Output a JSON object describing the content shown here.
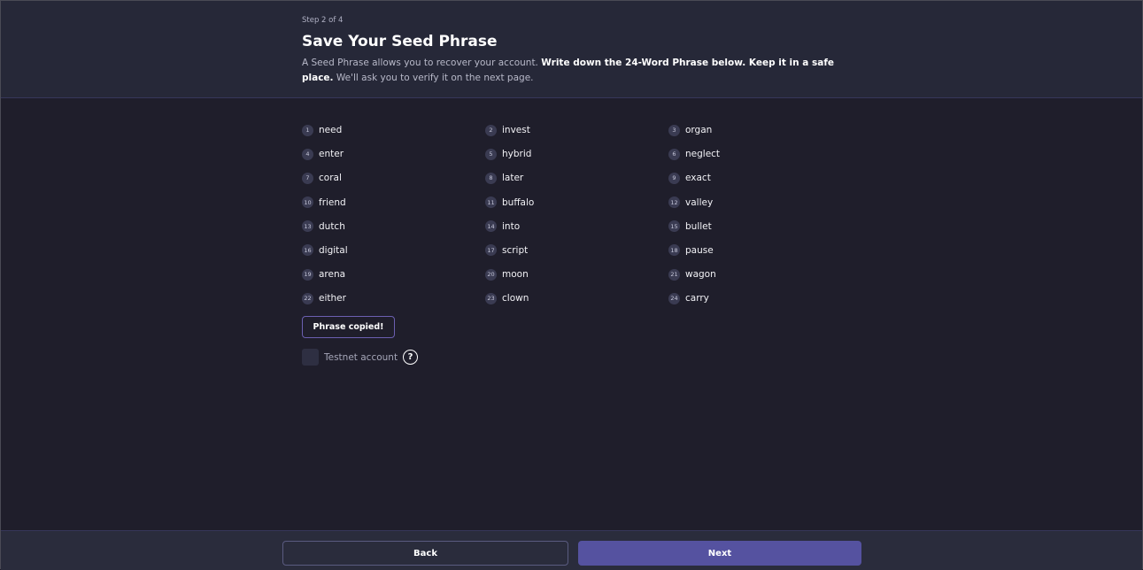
{
  "header": {
    "step": "Step 2 of 4",
    "title": "Save Your Seed Phrase",
    "desc_normal1": "A Seed Phrase allows you to recover your account. ",
    "desc_bold": "Write down the 24-Word Phrase below. Keep it in a safe place.",
    "desc_normal2": " We'll ask you to verify it on the next page."
  },
  "words": [
    {
      "n": "1",
      "w": "need"
    },
    {
      "n": "2",
      "w": "invest"
    },
    {
      "n": "3",
      "w": "organ"
    },
    {
      "n": "4",
      "w": "enter"
    },
    {
      "n": "5",
      "w": "hybrid"
    },
    {
      "n": "6",
      "w": "neglect"
    },
    {
      "n": "7",
      "w": "coral"
    },
    {
      "n": "8",
      "w": "later"
    },
    {
      "n": "9",
      "w": "exact"
    },
    {
      "n": "10",
      "w": "friend"
    },
    {
      "n": "11",
      "w": "buffalo"
    },
    {
      "n": "12",
      "w": "valley"
    },
    {
      "n": "13",
      "w": "dutch"
    },
    {
      "n": "14",
      "w": "into"
    },
    {
      "n": "15",
      "w": "bullet"
    },
    {
      "n": "16",
      "w": "digital"
    },
    {
      "n": "17",
      "w": "script"
    },
    {
      "n": "18",
      "w": "pause"
    },
    {
      "n": "19",
      "w": "arena"
    },
    {
      "n": "20",
      "w": "moon"
    },
    {
      "n": "21",
      "w": "wagon"
    },
    {
      "n": "22",
      "w": "either"
    },
    {
      "n": "23",
      "w": "clown"
    },
    {
      "n": "24",
      "w": "carry"
    }
  ],
  "copy_label": "Phrase copied!",
  "testnet": {
    "label": "Testnet account",
    "help_glyph": "?",
    "checked": false
  },
  "footer": {
    "back_label": "Back",
    "next_label": "Next"
  },
  "colors": {
    "background": "#1f1e2b",
    "header": "#262838",
    "accent": "#5552a0"
  }
}
